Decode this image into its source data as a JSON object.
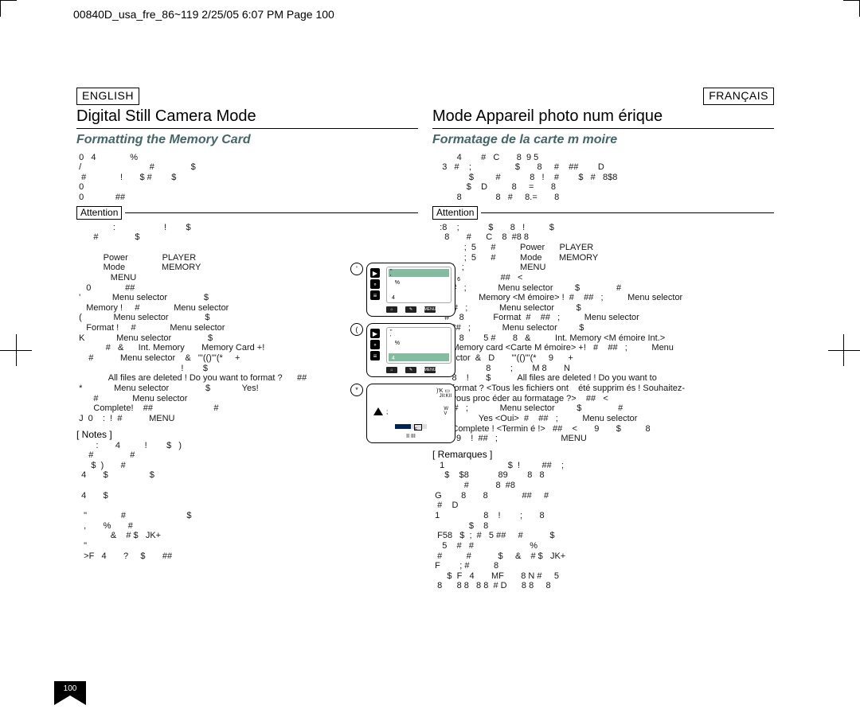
{
  "header_line": "00840D_usa_fre_86~119  2/25/05  6:07 PM  Page 100",
  "page_number": "100",
  "left": {
    "lang": "ENGLISH",
    "title": "Digital Still Camera Mode",
    "subtitle": "Formatting the Memory Card",
    "intro": " 0   4              %\n /                            #               $\n  #              !       $ #        $\n 0\n 0             ##",
    "attention_label": "Attention",
    "attention_body": "               :                    !        $\n       #               $\n\n           Power              PLAYER\n           Mode               MEMORY\n              MENU\n    0              ##\n '             Menu selector               $\n    Memory !     #              Menu selector\n (             Menu selector               $\n    Format !     #              Menu selector\n K             Menu selector               $\n            #   &      Int. Memory       Memory Card +!\n     #           Menu selector    &   \"'(()\"'(*     +\n                                           !        $\n             All files are deleted ! Do you want to format ?      ##\n *             Menu selector               $             Yes!\n       #              Menu selector\n       Complete!    ##                         #\n J  0    :  !  #           MENU",
    "notes_label": "[ Notes ]",
    "notes_body": "        :       4          !        $   )\n     #               #\n      $  )       #\n  4       $                 $\n\n  4       $\n\n   \"              #                         $\n   ,       %       #\n              &    # $   JK+\n   \"\n   >F   4       ?     $       ##"
  },
  "right": {
    "lang": "FRANÇAIS",
    "title": "Mode Appareil photo num érique",
    "subtitle": "Formatage de la carte m moire",
    "intro": "          4        #   C       8  9 5\n    3   #    ;                  $       8     #    ##        D\n               $         #            8   !    #        $   #   8$8\n              $    D          8     =       8\n          8              8   #     8.=       8",
    "attention_label": "Attention",
    "attention_body": "   :8    ;            $       8   !          $\n     8       #      C    8  #8 8\n             ;  5      #          Power      PLAYER\n             ;  5      #          Mode       MEMORY\n    ,##   ;                       MENU\n                            ##   <\n '   \"8#   ;             Menu selector         $               #\n     8            Memory <M émoire> !  #    ##   ;          Menu selector\n (   \"8#   ;             Menu selector         $\n     #    8            Format  #    ##   ;          Menu selector\n K   \"8#   ;             Menu selector         $\n     #    8        5 #       8   &          Int. Memory <M émoire Int.>\n        Memory card <Carte M émoire> +!   #    ##   ;          Menu\n   selector  &   D       \"'(()\"'(*     9      +\n                      8        ;        M 8       N\n        8    !       $           All files are deleted ! Do you want to\n        format ? <Tous les fichiers ont    été supprim és ! Souhaitez-\n        vous proc éder au formatage ?>    ##   <\n *   \"8#   ;             Menu selector         $               #\n     8            Yes <Oui>  #    ##   ;          Menu selector\n        Complete ! <Termin é !>   ##    <       9       $          8\n J       9    !  ##   ;                          MENU",
    "notes_label": "[ Remarques ]",
    "notes_body": "   1                          $  !         ##    ;\n     $    $8            89        8   8\n             #           8  #8\n G        8       8              ##     #\n  #    D\n 1                  8    !        ;       8\n               $    8\n  F58   $  ;  #   5 ##     #           $\n    5    #   #                       %\n  #          #           $     &    # $   JK+\n F        ; #          8\n      $  F   4       MF       8 N #     5\n  8      8 8   8 8  # D      8 8     8"
  },
  "screens": {
    "marker_top": "'",
    "marker_mid": "(",
    "marker_bot": "*",
    "num_6": "6",
    "num_4a": "4",
    "num_4b": "4",
    "menu_label": "MENU",
    "top_r1": ")'K",
    "top_r2": "JII:KII",
    "vert_WV": "W\nV",
    "f_label": "F",
    "bottom_glyph": "II III",
    "percent": "%",
    "semi": ";"
  }
}
